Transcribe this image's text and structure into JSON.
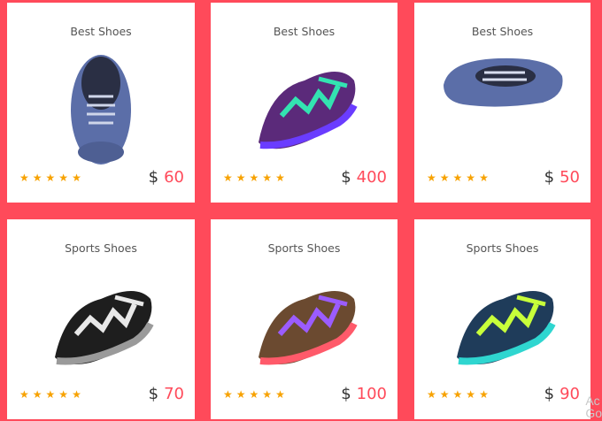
{
  "products": [
    {
      "title": "Best Shoes",
      "currency": "$",
      "price": "60",
      "rating": 5,
      "icon": "canvas-shoe-top-icon"
    },
    {
      "title": "Best Shoes",
      "currency": "$",
      "price": "400",
      "rating": 5,
      "icon": "purple-green-sneaker-icon"
    },
    {
      "title": "Best Shoes",
      "currency": "$",
      "price": "50",
      "rating": 5,
      "icon": "canvas-shoe-side-icon"
    },
    {
      "title": "Sports Shoes",
      "currency": "$",
      "price": "70",
      "rating": 5,
      "icon": "black-white-sneaker-icon"
    },
    {
      "title": "Sports Shoes",
      "currency": "$",
      "price": "100",
      "rating": 5,
      "icon": "brown-purple-sneaker-icon"
    },
    {
      "title": "Sports Shoes",
      "currency": "$",
      "price": "90",
      "rating": 5,
      "icon": "navy-lime-sneaker-icon"
    }
  ],
  "colors": {
    "background": "#ff4a5a",
    "accent": "#ff4a5a",
    "star": "#f7a200"
  },
  "watermark": "Ac\nGo"
}
